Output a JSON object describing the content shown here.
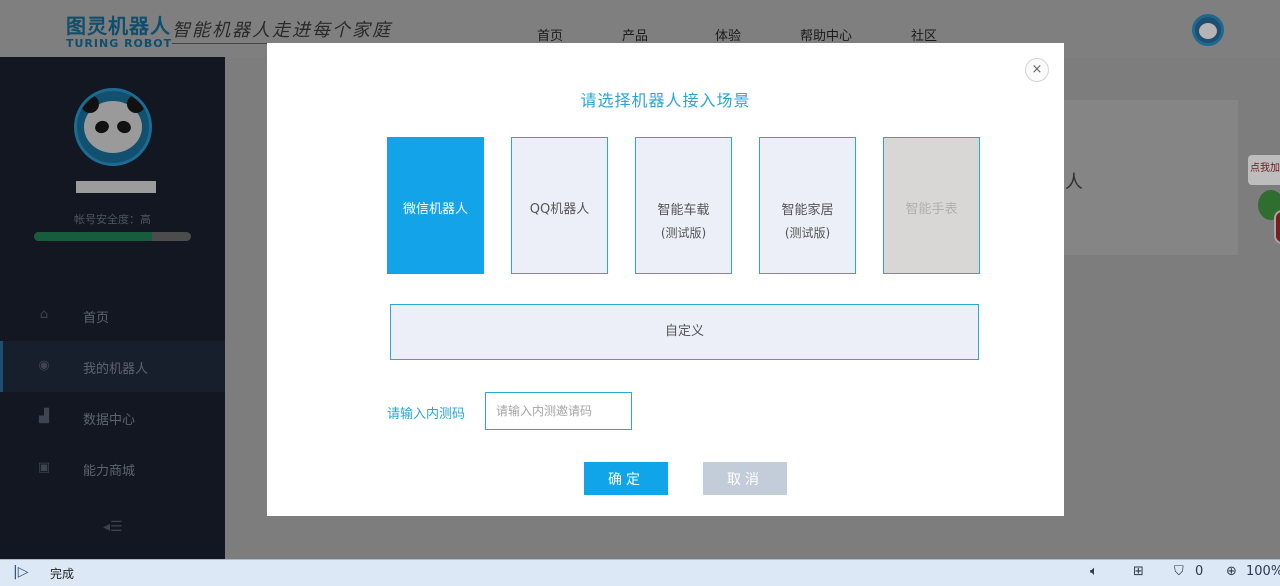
{
  "topbar": {
    "logo_cn": "图灵机器人",
    "logo_en": "TURING ROBOT",
    "slogan": "智能机器人走进每个家庭",
    "nav": [
      "首页",
      "产品",
      "体验",
      "帮助中心",
      "社区"
    ]
  },
  "sidebar": {
    "security_label": "帐号安全度：高",
    "security_level": 0.75,
    "items": [
      {
        "label": "首页",
        "icon": "home-icon"
      },
      {
        "label": "我的机器人",
        "icon": "robot-eye-icon"
      },
      {
        "label": "数据中心",
        "icon": "bar-chart-icon"
      },
      {
        "label": "能力商城",
        "icon": "store-icon"
      }
    ],
    "active_item": "我的机器人"
  },
  "background": {
    "card_char": "人",
    "badge": "点我加"
  },
  "modal": {
    "title": "请选择机器人接入场景",
    "close": "×",
    "scenes": [
      {
        "label": "微信机器人",
        "sub": "",
        "state": "selected"
      },
      {
        "label": "QQ机器人",
        "sub": "",
        "state": "normal"
      },
      {
        "label": "智能车载",
        "sub": "(测试版)",
        "state": "normal"
      },
      {
        "label": "智能家居",
        "sub": "(测试版)",
        "state": "normal"
      },
      {
        "label": "智能手表",
        "sub": "",
        "state": "disabled"
      }
    ],
    "custom_label": "自定义",
    "code_label": "请输入内测码",
    "code_placeholder": "请输入内测邀请码",
    "confirm": "确定",
    "cancel": "取消"
  },
  "statusbar": {
    "status": "完成",
    "security_count": "0",
    "zoom": "100%"
  },
  "colors": {
    "accent": "#12a3e8",
    "title": "#2aa4d2",
    "cancel": "#c3ccd9"
  }
}
